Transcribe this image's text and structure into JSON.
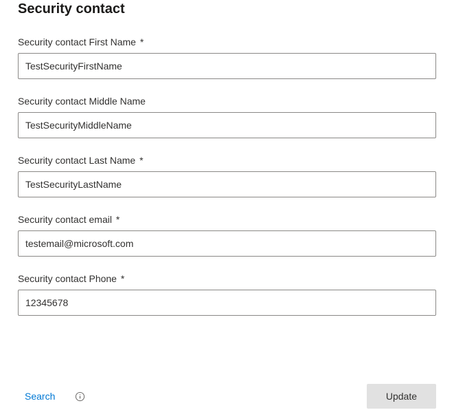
{
  "section": {
    "title": "Security contact"
  },
  "fields": {
    "first_name": {
      "label": "Security contact First Name",
      "required_mark": "*",
      "value": "TestSecurityFirstName"
    },
    "middle_name": {
      "label": "Security contact Middle Name",
      "required_mark": "",
      "value": "TestSecurityMiddleName"
    },
    "last_name": {
      "label": "Security contact Last Name",
      "required_mark": "*",
      "value": "TestSecurityLastName"
    },
    "email": {
      "label": "Security contact email",
      "required_mark": "*",
      "value": "testemail@microsoft.com"
    },
    "phone": {
      "label": "Security contact Phone",
      "required_mark": "*",
      "value": "12345678"
    }
  },
  "footer": {
    "search_label": "Search",
    "info_icon": "info-icon",
    "update_label": "Update"
  }
}
